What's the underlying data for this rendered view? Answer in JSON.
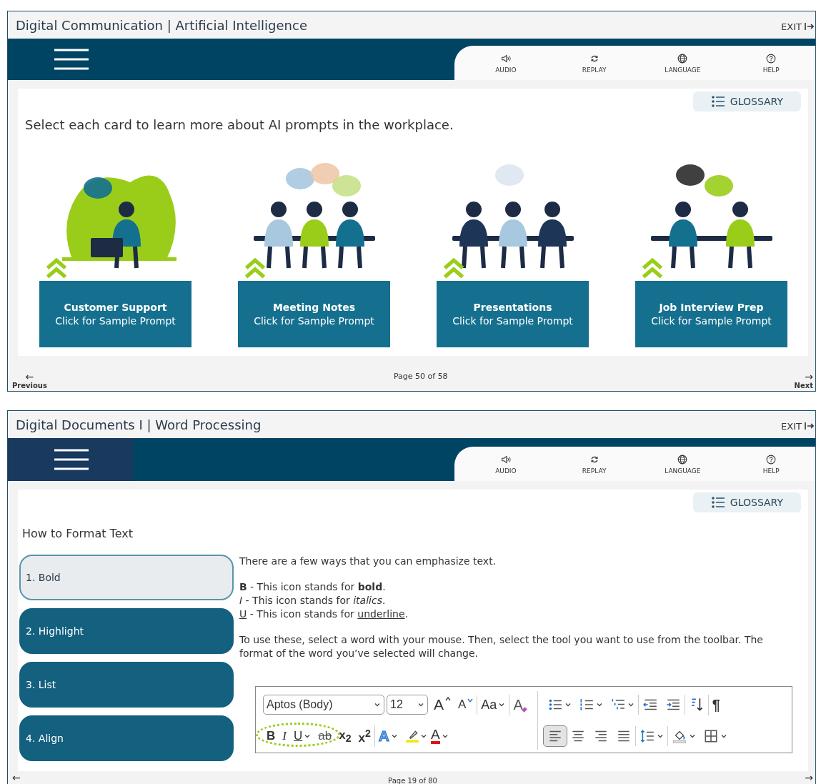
{
  "screens": [
    {
      "title": "Digital Communication | Artificial Intelligence",
      "exit": "EXIT",
      "menu_active": false,
      "tools": [
        {
          "label": "AUDIO"
        },
        {
          "label": "REPLAY"
        },
        {
          "label": "LANGUAGE"
        },
        {
          "label": "HELP"
        }
      ],
      "glossary": "GLOSSARY",
      "instruction": "Select each card to learn more about AI prompts in the workplace.",
      "cards": [
        {
          "title": "Customer Support",
          "subtitle": "Click for Sample Prompt"
        },
        {
          "title": "Meeting Notes",
          "subtitle": "Click for Sample Prompt"
        },
        {
          "title": "Presentations",
          "subtitle": "Click for Sample Prompt"
        },
        {
          "title": "Job Interview Prep",
          "subtitle": "Click for Sample Prompt"
        }
      ],
      "footer": {
        "back_arrow": "←",
        "previous": "Previous",
        "page": "Page 50 of 58",
        "next_arrow": "→",
        "next": "Next"
      }
    },
    {
      "title": "Digital Documents I | Word Processing",
      "exit": "EXIT",
      "menu_active": true,
      "tools": [
        {
          "label": "AUDIO"
        },
        {
          "label": "REPLAY"
        },
        {
          "label": "LANGUAGE"
        },
        {
          "label": "HELP"
        }
      ],
      "glossary": "GLOSSARY",
      "heading": "How to Format Text",
      "topics": [
        {
          "label": "1. Bold",
          "selected": true
        },
        {
          "label": "2. Highlight",
          "selected": false
        },
        {
          "label": "3. List",
          "selected": false
        },
        {
          "label": "4. Align",
          "selected": false
        }
      ],
      "intro": "There are a few ways that you can emphasize text.",
      "lines": [
        {
          "kind": "bold",
          "key": "B",
          "text": " - This icon stands for ",
          "word": "bold",
          "end": "."
        },
        {
          "kind": "italic",
          "key": "I",
          "text": " - This icon stands for ",
          "word": "italics",
          "end": "."
        },
        {
          "kind": "underline",
          "key": "U",
          "text": " - This icon stands for ",
          "word": "underline",
          "end": "."
        }
      ],
      "outro": "To use these, select a word with your mouse. Then, select the tool you want to use from the toolbar. The format of the word you’ve selected will change.",
      "ribbon": {
        "font": "Aptos (Body)",
        "size": "12",
        "top_left": [
          "A",
          "A",
          "Aa",
          "A"
        ],
        "bottom_left": [
          "B",
          "I",
          "U",
          "ab",
          "x$_{2}$",
          "x$^{2}$",
          "A",
          "A"
        ],
        "pilcrow": "¶",
        "alignments": [
          {
            "selected": true
          },
          {
            "selected": false
          },
          {
            "selected": false
          },
          {
            "selected": false
          }
        ]
      },
      "footer": {
        "back_arrow": "←",
        "page": "Page 19 of 80",
        "next_arrow": "→"
      }
    }
  ]
}
